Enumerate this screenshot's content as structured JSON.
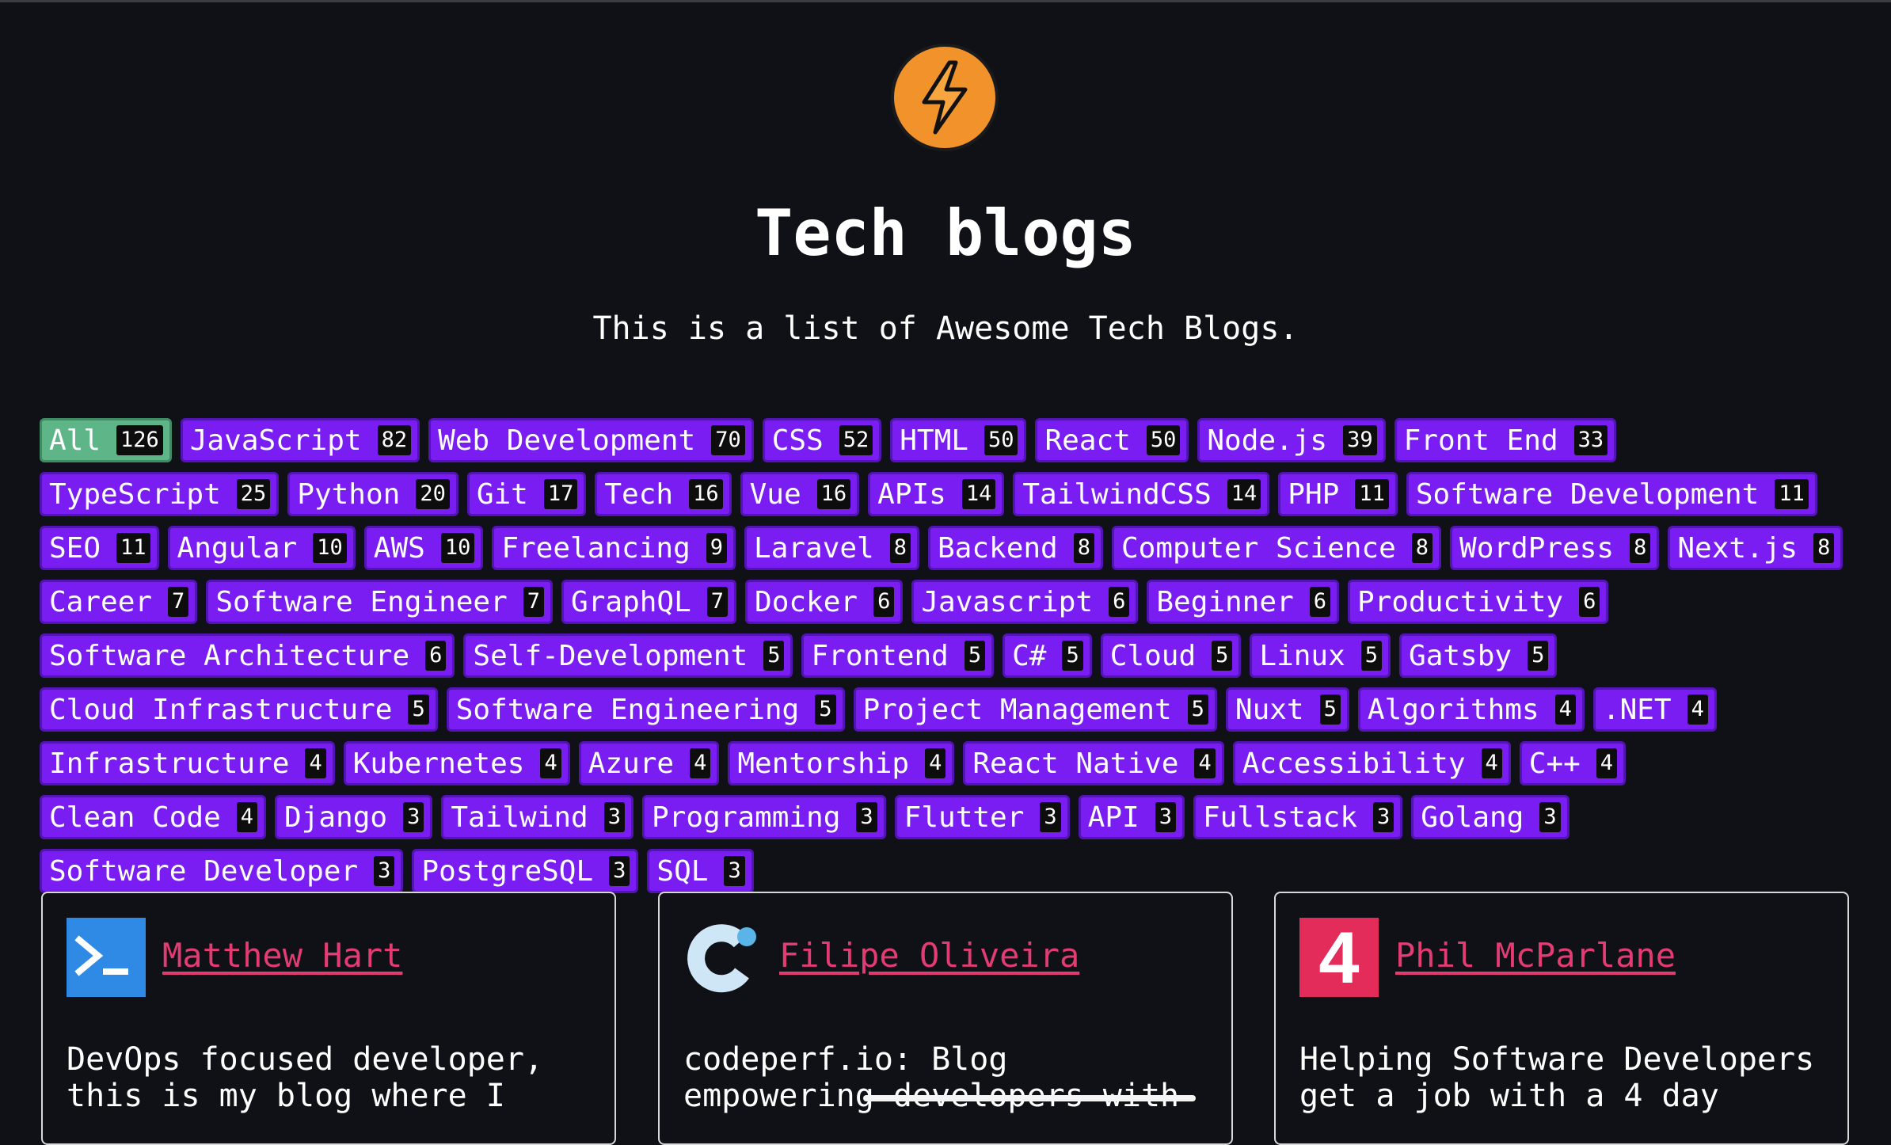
{
  "header": {
    "logo_icon": "lightning-bolt-icon",
    "title": "Tech blogs",
    "subtitle": "This is a list of Awesome Tech Blogs."
  },
  "colors": {
    "background": "#0f1117",
    "tag_bg": "#7a1df2",
    "tag_active_bg": "#5eb688",
    "author_link": "#e23c72",
    "logo": "#f2922b"
  },
  "tags": [
    {
      "label": "All",
      "count": "126",
      "active": true
    },
    {
      "label": "JavaScript",
      "count": "82"
    },
    {
      "label": "Web Development",
      "count": "70"
    },
    {
      "label": "CSS",
      "count": "52"
    },
    {
      "label": "HTML",
      "count": "50"
    },
    {
      "label": "React",
      "count": "50"
    },
    {
      "label": "Node.js",
      "count": "39"
    },
    {
      "label": "Front End",
      "count": "33"
    },
    {
      "label": "TypeScript",
      "count": "25"
    },
    {
      "label": "Python",
      "count": "20"
    },
    {
      "label": "Git",
      "count": "17"
    },
    {
      "label": "Tech",
      "count": "16"
    },
    {
      "label": "Vue",
      "count": "16"
    },
    {
      "label": "APIs",
      "count": "14"
    },
    {
      "label": "TailwindCSS",
      "count": "14"
    },
    {
      "label": "PHP",
      "count": "11"
    },
    {
      "label": "Software Development",
      "count": "11"
    },
    {
      "label": "SEO",
      "count": "11"
    },
    {
      "label": "Angular",
      "count": "10"
    },
    {
      "label": "AWS",
      "count": "10"
    },
    {
      "label": "Freelancing",
      "count": "9"
    },
    {
      "label": "Laravel",
      "count": "8"
    },
    {
      "label": "Backend",
      "count": "8"
    },
    {
      "label": "Computer Science",
      "count": "8"
    },
    {
      "label": "WordPress",
      "count": "8"
    },
    {
      "label": "Next.js",
      "count": "8"
    },
    {
      "label": "Career",
      "count": "7"
    },
    {
      "label": "Software Engineer",
      "count": "7"
    },
    {
      "label": "GraphQL",
      "count": "7"
    },
    {
      "label": "Docker",
      "count": "6"
    },
    {
      "label": "Javascript",
      "count": "6"
    },
    {
      "label": "Beginner",
      "count": "6"
    },
    {
      "label": "Productivity",
      "count": "6"
    },
    {
      "label": "Software Architecture",
      "count": "6"
    },
    {
      "label": "Self-Development",
      "count": "5"
    },
    {
      "label": "Frontend",
      "count": "5"
    },
    {
      "label": "C#",
      "count": "5"
    },
    {
      "label": "Cloud",
      "count": "5"
    },
    {
      "label": "Linux",
      "count": "5"
    },
    {
      "label": "Gatsby",
      "count": "5"
    },
    {
      "label": "Cloud Infrastructure",
      "count": "5"
    },
    {
      "label": "Software Engineering",
      "count": "5"
    },
    {
      "label": "Project Management",
      "count": "5"
    },
    {
      "label": "Nuxt",
      "count": "5"
    },
    {
      "label": "Algorithms",
      "count": "4"
    },
    {
      "label": ".NET",
      "count": "4"
    },
    {
      "label": "Infrastructure",
      "count": "4"
    },
    {
      "label": "Kubernetes",
      "count": "4"
    },
    {
      "label": "Azure",
      "count": "4"
    },
    {
      "label": "Mentorship",
      "count": "4"
    },
    {
      "label": "React Native",
      "count": "4"
    },
    {
      "label": "Accessibility",
      "count": "4"
    },
    {
      "label": "C++",
      "count": "4"
    },
    {
      "label": "Clean Code",
      "count": "4"
    },
    {
      "label": "Django",
      "count": "3"
    },
    {
      "label": "Tailwind",
      "count": "3"
    },
    {
      "label": "Programming",
      "count": "3"
    },
    {
      "label": "Flutter",
      "count": "3"
    },
    {
      "label": "API",
      "count": "3"
    },
    {
      "label": "Fullstack",
      "count": "3"
    },
    {
      "label": "Golang",
      "count": "3"
    },
    {
      "label": "Software Developer",
      "count": "3"
    },
    {
      "label": "PostgreSQL",
      "count": "3"
    },
    {
      "label": "SQL",
      "count": "3"
    }
  ],
  "cards": [
    {
      "author": "Matthew Hart",
      "avatar_icon": "terminal-prompt-icon",
      "description_line1": "DevOps focused developer,",
      "description_line2": "this is my blog where I"
    },
    {
      "author": "Filipe Oliveira",
      "avatar_icon": "codeperf-logo-icon",
      "description_line1": "codeperf.io: Blog",
      "description_line2": "empowering developers with"
    },
    {
      "author": "Phil McParlane",
      "avatar_icon": "four-day-week-logo-icon",
      "description_line1": "Helping Software Developers",
      "description_line2": "get a job with a 4 day"
    }
  ]
}
